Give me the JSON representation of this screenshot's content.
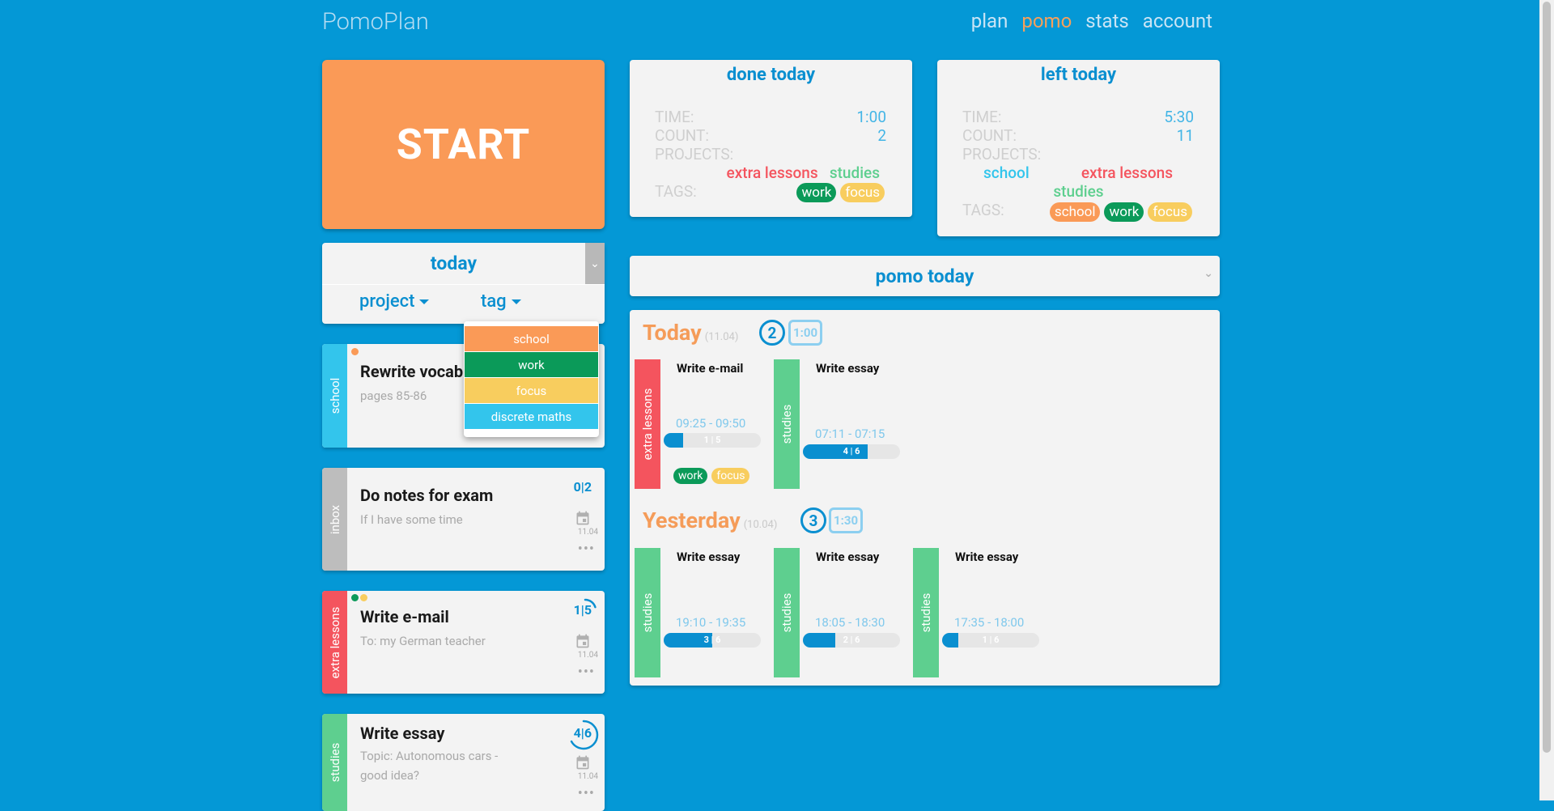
{
  "brand": "PomoPlan",
  "nav": [
    "plan",
    "pomo",
    "stats",
    "account"
  ],
  "start_label": "START",
  "filter": {
    "title": "today",
    "project": "project",
    "tag": "tag"
  },
  "tag_menu": [
    "school",
    "work",
    "focus",
    "discrete maths"
  ],
  "colors": {
    "school": "#fa9a57",
    "work": "#0b9a59",
    "focus": "#f8cd5e",
    "discrete_maths": "#33c5ec",
    "extra_lessons": "#f4545e",
    "studies": "#5ecf8f",
    "inbox": "#bdbdbd"
  },
  "tasks": [
    {
      "project": "school",
      "title": "Rewrite vocab",
      "subtitle": "pages 85-86"
    },
    {
      "project": "inbox",
      "title": "Do notes for exam",
      "subtitle": "If I have some time",
      "count": "0|2",
      "date": "11.04"
    },
    {
      "project": "extra lessons",
      "title": "Write e-mail",
      "subtitle": "To: my German teacher",
      "count": "1|5",
      "date": "11.04",
      "progress": 0.2
    },
    {
      "project": "studies",
      "title": "Write essay",
      "subtitle": "Topic: Autonomous cars - good idea?",
      "count": "4|6",
      "date": "11.04",
      "progress": 0.67
    }
  ],
  "done_today": {
    "title": "done today",
    "time_label": "TIME:",
    "time": "1:00",
    "count_label": "COUNT:",
    "count": "2",
    "projects_label": "PROJECTS:",
    "projects": [
      "extra lessons",
      "studies"
    ],
    "tags_label": "TAGS:",
    "tags": [
      "work",
      "focus"
    ]
  },
  "left_today": {
    "title": "left today",
    "time_label": "TIME:",
    "time": "5:30",
    "count_label": "COUNT:",
    "count": "11",
    "projects_label": "PROJECTS:",
    "projects": [
      "school",
      "extra lessons",
      "studies"
    ],
    "tags_label": "TAGS:",
    "tags": [
      "school",
      "work",
      "focus"
    ]
  },
  "pomo_selector": "pomo today",
  "history": [
    {
      "day": "Today",
      "date": "(11.04)",
      "count": "2",
      "total": "1:00",
      "entries": [
        {
          "project": "extra lessons",
          "title": "Write e-mail",
          "time": "09:25 - 09:50",
          "bar": "1 | 5",
          "progress": 0.2,
          "tags": [
            "work",
            "focus"
          ]
        },
        {
          "project": "studies",
          "title": "Write essay",
          "time": "07:11 - 07:15",
          "bar": "4 | 6",
          "progress": 0.67
        }
      ]
    },
    {
      "day": "Yesterday",
      "date": "(10.04)",
      "count": "3",
      "total": "1:30",
      "entries": [
        {
          "project": "studies",
          "title": "Write essay",
          "time": "19:10 - 19:35",
          "bar": "3 | 6",
          "progress": 0.5
        },
        {
          "project": "studies",
          "title": "Write essay",
          "time": "18:05 - 18:30",
          "bar": "2 | 6",
          "progress": 0.33
        },
        {
          "project": "studies",
          "title": "Write essay",
          "time": "17:35 - 18:00",
          "bar": "1 | 6",
          "progress": 0.17
        }
      ]
    }
  ]
}
